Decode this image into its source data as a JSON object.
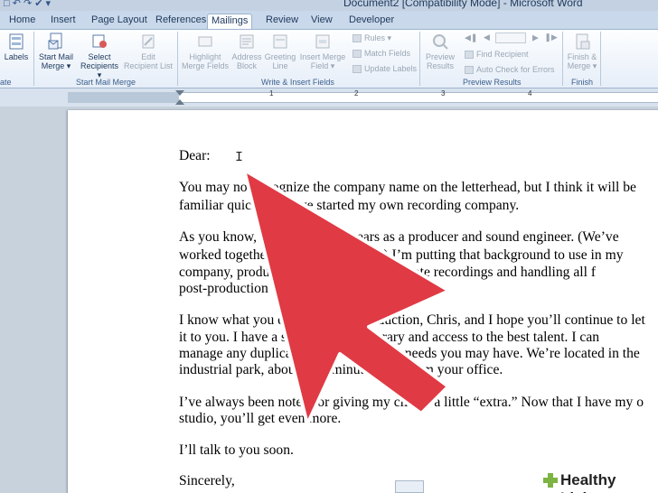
{
  "window": {
    "title": "Document2 [Compatibility Mode] - Microsoft Word"
  },
  "tabs": [
    "Home",
    "Insert",
    "Page Layout",
    "References",
    "Mailings",
    "Review",
    "View",
    "Developer"
  ],
  "active_tab": "Mailings",
  "ribbon": {
    "groups": {
      "create": "ate",
      "start_mail_merge": "Start Mail Merge",
      "write_insert": "Write & Insert Fields",
      "preview": "Preview Results",
      "finish": "Finish"
    },
    "labels_btn": "Labels",
    "start_mail_merge_btn": [
      "Start Mail",
      "Merge ▾"
    ],
    "select_recipients_btn": [
      "Select",
      "Recipients ▾"
    ],
    "edit_recipient_list_btn": [
      "Edit",
      "Recipient List"
    ],
    "highlight_merge_fields_btn": [
      "Highlight",
      "Merge Fields"
    ],
    "address_block_btn": [
      "Address",
      "Block"
    ],
    "greeting_line_btn": [
      "Greeting",
      "Line"
    ],
    "insert_merge_field_btn": [
      "Insert Merge",
      "Field ▾"
    ],
    "rules": "Rules ▾",
    "match_fields": "Match Fields",
    "update_labels": "Update Labels",
    "preview_results_btn": [
      "Preview",
      "Results"
    ],
    "find_recipient": "Find Recipient",
    "auto_check": "Auto Check for Errors",
    "finish_merge_btn": [
      "Finish &",
      "Merge ▾"
    ]
  },
  "ruler": {
    "marks": [
      "1",
      "2",
      "3",
      "4"
    ]
  },
  "document": {
    "lines": [
      "Dear:",
      "You may not recognize the company name on the letterhead, but I think it will be",
      "familiar quickly — I’ve started my own recording company.",
      "As you know, I’ve worked 18 years as a producer and sound engineer. (We’ve",
      "worked together on several projects.) I’m putting that background to use in my",
      "company, producing music, handling remote recordings and handling all f",
      "post-production work.",
      "I know what you expect from a production, Chris, and I hope you’ll continue to let",
      "it to you. I have a sizeable sound library and access to the best talent. I can",
      "manage any duplication and fulfillment needs you may have. We’re located in the",
      "industrial park, about a 10-minute drive from your office.",
      "I’ve always been noted for giving my clients a little “extra.” Now that I have my o",
      "studio, you’ll get even more.",
      "I’ll talk to you soon.",
      "Sincerely,"
    ]
  },
  "watermark": {
    "text": "Healthy Living"
  },
  "colors": {
    "arrow": "#e03a44",
    "arrow_outline": "#ffffff",
    "ribbon_bg": "#e6eef8"
  }
}
